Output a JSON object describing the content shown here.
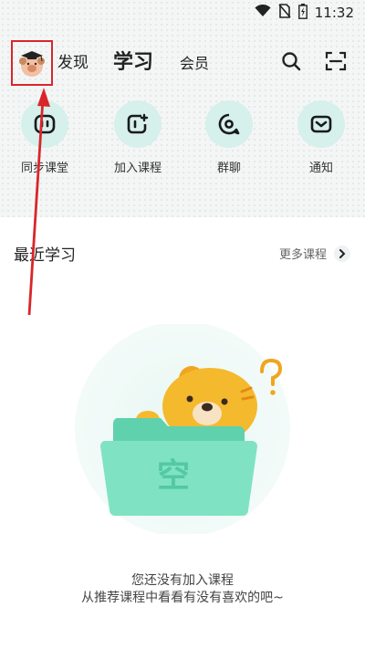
{
  "status_bar": {
    "time": "11:32",
    "icons": [
      "wifi-icon",
      "no-sim-icon",
      "battery-icon"
    ]
  },
  "header": {
    "tabs": [
      {
        "label": "发现",
        "active": false
      },
      {
        "label": "学习",
        "active": true
      },
      {
        "label": "会员",
        "active": false
      }
    ],
    "right_icons": [
      "search-icon",
      "scan-icon"
    ]
  },
  "quick_actions": [
    {
      "label": "同步课堂",
      "icon": "robot-icon"
    },
    {
      "label": "加入课程",
      "icon": "add-course-icon"
    },
    {
      "label": "群聊",
      "icon": "chat-icon"
    },
    {
      "label": "通知",
      "icon": "mail-icon"
    }
  ],
  "recent": {
    "title": "最近学习",
    "more_label": "更多课程"
  },
  "empty_state": {
    "folder_text": "空",
    "line1": "您还没有加入课程",
    "line2": "从推荐课程中看看有没有喜欢的吧~"
  },
  "colors": {
    "accent_mint": "#d6f0ec",
    "annotation_red": "#d9262a",
    "folder_green": "#6fdcb8",
    "bear_yellow": "#f5b92e"
  }
}
